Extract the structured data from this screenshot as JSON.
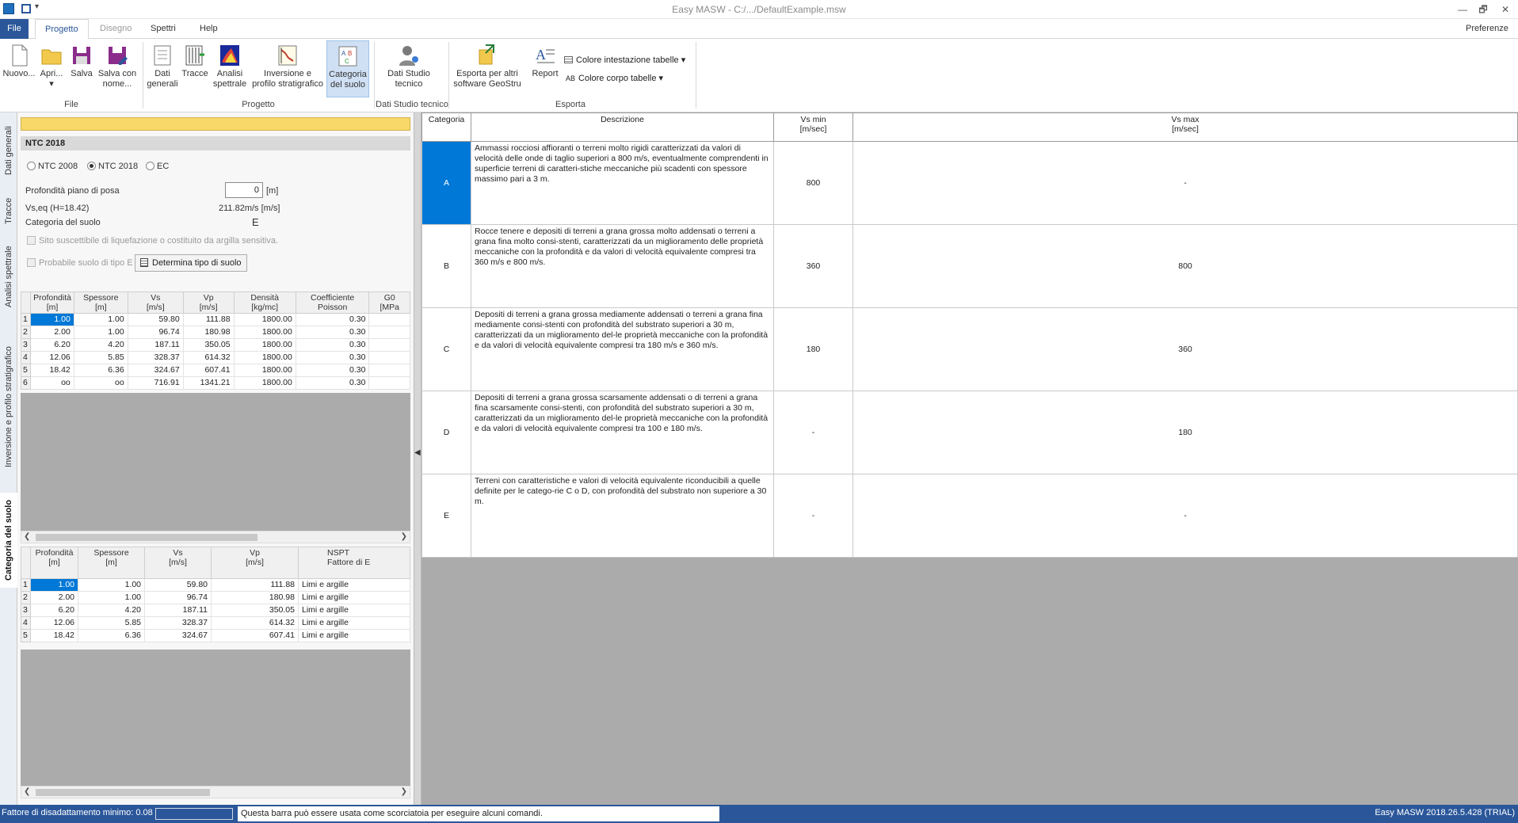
{
  "titlebar": {
    "title": "Easy MASW - C:/.../DefaultExample.msw",
    "restore_glyph": "🗗",
    "close_glyph": "✕",
    "minimize_glyph": "—"
  },
  "menu": {
    "tabs": [
      "File",
      "Progetto",
      "Disegno",
      "Spettri",
      "Help"
    ],
    "active": "Progetto",
    "preferences": "Preferenze"
  },
  "ribbon": {
    "buttons": [
      {
        "label": "Nuovo...",
        "icon": "new-file-icon"
      },
      {
        "label": "Apri...",
        "icon": "open-folder-icon"
      },
      {
        "label": "Salva",
        "icon": "save-icon"
      },
      {
        "label": "Salva con nome...",
        "icon": "save-as-icon"
      },
      {
        "label": "Dati generali",
        "icon": "general-data-icon"
      },
      {
        "label": "Tracce",
        "icon": "traces-icon"
      },
      {
        "label": "Analisi spettrale",
        "icon": "spectral-analysis-icon"
      },
      {
        "label": "Inversione e profilo stratigrafico",
        "icon": "inversion-profile-icon"
      },
      {
        "label": "Categoria del suolo",
        "icon": "soil-category-icon"
      },
      {
        "label": "Dati Studio tecnico",
        "icon": "studio-data-icon"
      },
      {
        "label": "Esporta per altri software GeoStru",
        "icon": "export-icon"
      },
      {
        "label": "Report",
        "icon": "report-icon"
      }
    ],
    "groups": {
      "file": "File",
      "progetto": "Progetto",
      "studio": "Dati Studio tecnico",
      "esporta": "Esporta"
    },
    "colore_intestazione": "Colore intestazione tabelle",
    "colore_corpo": "Colore corpo tabelle"
  },
  "sidetabs": [
    "Dati generali",
    "Tracce",
    "Analisi spettrale",
    "Inversione e profilo stratigrafico",
    "Categoria del suolo"
  ],
  "left": {
    "header": "NTC 2018",
    "radios": [
      "NTC 2008",
      "NTC 2018",
      "EC"
    ],
    "radio_selected": "NTC 2018",
    "profondita_label": "Profondità piano di posa",
    "profondita_value": "0",
    "profondita_unit": "[m]",
    "vseq_label": "Vs,eq (H=18.42)",
    "vseq_value": "211.82m/s [m/s]",
    "categoria_label": "Categoria del suolo",
    "categoria_value": "E",
    "chk_liquefazione": "Sito suscettibile di liquefazione o costituito da argilla sensitiva.",
    "chk_tipoE": "Probabile suolo di tipo E",
    "btn_determina": "Determina tipo di suolo",
    "grid1": {
      "headers": [
        [
          "Profondità",
          "[m]"
        ],
        [
          "Spessore",
          "[m]"
        ],
        [
          "Vs",
          "[m/s]"
        ],
        [
          "Vp",
          "[m/s]"
        ],
        [
          "Densità",
          "[kg/mc]"
        ],
        [
          "Coefficiente",
          "Poisson"
        ],
        [
          "G0",
          "[MPa"
        ]
      ],
      "rows": [
        [
          "1",
          "1.00",
          "1.00",
          "59.80",
          "111.88",
          "1800.00",
          "0.30",
          ""
        ],
        [
          "2",
          "2.00",
          "1.00",
          "96.74",
          "180.98",
          "1800.00",
          "0.30",
          ""
        ],
        [
          "3",
          "6.20",
          "4.20",
          "187.11",
          "350.05",
          "1800.00",
          "0.30",
          ""
        ],
        [
          "4",
          "12.06",
          "5.85",
          "328.37",
          "614.32",
          "1800.00",
          "0.30",
          ""
        ],
        [
          "5",
          "18.42",
          "6.36",
          "324.67",
          "607.41",
          "1800.00",
          "0.30",
          ""
        ],
        [
          "6",
          "oo",
          "oo",
          "716.91",
          "1341.21",
          "1800.00",
          "0.30",
          ""
        ]
      ]
    },
    "grid2": {
      "headers": [
        [
          "Profondità",
          "[m]"
        ],
        [
          "Spessore",
          "[m]"
        ],
        [
          "Vs",
          "[m/s]"
        ],
        [
          "Vp",
          "[m/s]"
        ],
        [
          "NSPT",
          "Fattore di E"
        ]
      ],
      "rows": [
        [
          "1",
          "1.00",
          "1.00",
          "59.80",
          "111.88",
          "Limi e argille"
        ],
        [
          "2",
          "2.00",
          "1.00",
          "96.74",
          "180.98",
          "Limi e argille"
        ],
        [
          "3",
          "6.20",
          "4.20",
          "187.11",
          "350.05",
          "Limi e argille"
        ],
        [
          "4",
          "12.06",
          "5.85",
          "328.37",
          "614.32",
          "Limi e argille"
        ],
        [
          "5",
          "18.42",
          "6.36",
          "324.67",
          "607.41",
          "Limi e argille"
        ]
      ]
    }
  },
  "categories": {
    "headers": {
      "cat": "Categoria",
      "desc": "Descrizione",
      "vsmin1": "Vs min",
      "vsmin2": "[m/sec]",
      "vsmax1": "Vs max",
      "vsmax2": "[m/sec]"
    },
    "rows": [
      {
        "cat": "A",
        "desc": "Ammassi rocciosi affioranti o terreni molto rigidi caratterizzati da valori di velocità delle onde di taglio superiori a 800 m/s, eventualmente comprendenti in superficie terreni di caratteri-stiche meccaniche più scadenti con spessore massimo pari a 3 m.",
        "vsmin": "800",
        "vsmax": "-"
      },
      {
        "cat": "B",
        "desc": "Rocce tenere e depositi di terreni a grana grossa molto addensati o terreni a grana fina molto consi-stenti, caratterizzati da un miglioramento delle proprietà meccaniche con la profondità e da valori di velocità equivalente compresi tra 360 m/s e 800 m/s.",
        "vsmin": "360",
        "vsmax": "800"
      },
      {
        "cat": "C",
        "desc": "Depositi di terreni a grana grossa mediamente addensati o terreni a grana fina mediamente consi-stenti con profondità del substrato superiori a 30 m, caratterizzati da un miglioramento del-le proprietà meccaniche con la profondità e da valori di velocità equivalente compresi tra 180 m/s e 360 m/s.",
        "vsmin": "180",
        "vsmax": "360"
      },
      {
        "cat": "D",
        "desc": "Depositi di terreni a grana grossa scarsamente addensati o di terreni a grana fina scarsamente consi-stenti, con profondità del substrato superiori a 30 m, caratterizzati da un miglioramento del-le proprietà meccaniche con la profondità e da valori di velocità equivalente compresi tra 100 e 180 m/s.",
        "vsmin": "-",
        "vsmax": "180"
      },
      {
        "cat": "E",
        "desc": "Terreni con caratteristiche e valori di velocità equivalente riconducibili a quelle definite per le catego-rie C o D, con profondità del substrato non superiore a 30 m.",
        "vsmin": "-",
        "vsmax": "-"
      }
    ]
  },
  "status": {
    "left": "Fattore di disadattamento minimo: 0.08",
    "message": "Questa barra può essere usata come scorciatoia per eseguire alcuni comandi.",
    "version": "Easy MASW 2018.26.5.428 (TRIAL)"
  },
  "colors": {
    "accent": "#2b579a",
    "selection": "#0078d7",
    "highlight": "#f9d86a"
  }
}
